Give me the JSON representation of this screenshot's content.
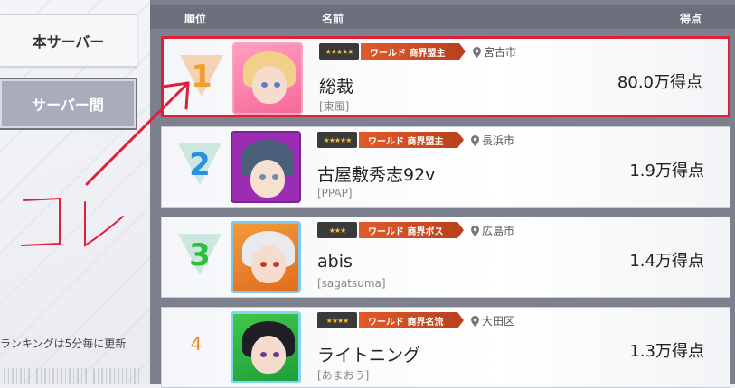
{
  "sidebar": {
    "tabs": [
      {
        "label": "本サーバー"
      },
      {
        "label": "サーバー間"
      }
    ],
    "update_note": "ランキングは5分毎に更新"
  },
  "annotation": {
    "text": "コレ",
    "color": "#e0203a"
  },
  "header": {
    "rank": "順位",
    "name": "名前",
    "score": "得点"
  },
  "rows": [
    {
      "rank": "1",
      "badge_stars": "★★★★★",
      "title": "ワールド 商界盟主",
      "location": "宮古市",
      "name": "総裁",
      "guild": "[東風]",
      "score": "80.0万得点"
    },
    {
      "rank": "2",
      "badge_stars": "★★★★★",
      "title": "ワールド 商界盟主",
      "location": "長浜市",
      "name": "古屋敷秀志92v",
      "guild": "[PPAP]",
      "score": "1.9万得点"
    },
    {
      "rank": "3",
      "badge_stars": "★★★",
      "title": "ワールド 商界ボス",
      "location": "広島市",
      "name": "abis",
      "guild": "[sagatsuma]",
      "score": "1.4万得点"
    },
    {
      "rank": "4",
      "badge_stars": "★★★★",
      "title": "ワールド 商界名流",
      "location": "大田区",
      "name": "ライトニング",
      "guild": "[あまおう]",
      "score": "1.3万得点"
    }
  ],
  "colors": {
    "highlight": "#e0203a",
    "rank1": "#f0a030",
    "rank2": "#2a8fe0",
    "rank3": "#2bbf3a",
    "rank4": "#ee8a14"
  }
}
